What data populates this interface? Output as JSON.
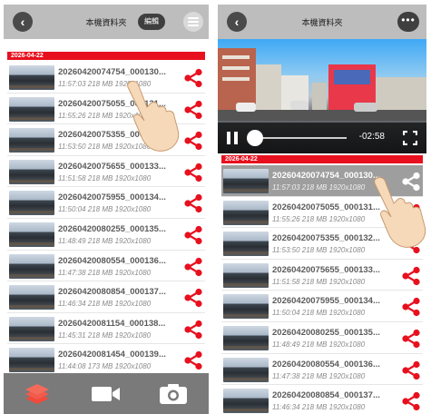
{
  "left": {
    "title": "本機資料夾",
    "edit_label": "編輯",
    "date": "2026-04-22",
    "files": [
      {
        "name": "20260420074754_000130...",
        "meta": "11:57:03 218 MB 1920x1080"
      },
      {
        "name": "20260420075055_000131...",
        "meta": "11:55:26 218 MB 1920x1080"
      },
      {
        "name": "20260420075355_000132...",
        "meta": "11:53:50 218 MB 1920x1080"
      },
      {
        "name": "20260420075655_000133...",
        "meta": "11:51:58 218 MB 1920x1080"
      },
      {
        "name": "20260420075955_000134...",
        "meta": "11:50:04 218 MB 1920x1080"
      },
      {
        "name": "20260420080255_000135...",
        "meta": "11:48:49 218 MB 1920x1080"
      },
      {
        "name": "20260420080554_000136...",
        "meta": "11:47:38 218 MB 1920x1080"
      },
      {
        "name": "20260420080854_000137...",
        "meta": "11:46:34 218 MB 1920x1080"
      },
      {
        "name": "20260420081154_000138...",
        "meta": "11:45:31 218 MB 1920x1080"
      },
      {
        "name": "20260420081454_000139...",
        "meta": "11:44:08 173 MB 1920x1080"
      }
    ],
    "tabs": [
      "layers-icon",
      "video-camera-icon",
      "camera-icon"
    ]
  },
  "right": {
    "title": "本機資料夾",
    "date": "2026-04-22",
    "player": {
      "remaining_time": "-02:58",
      "progress": 0.02
    },
    "files": [
      {
        "name": "20260420074754_000130...",
        "meta": "11:57:03 218 MB 1920x1080",
        "selected": true
      },
      {
        "name": "20260420075055_000131...",
        "meta": "11:55:26 218 MB 1920x1080"
      },
      {
        "name": "20260420075355_000132...",
        "meta": "11:53:50 218 MB 1920x1080"
      },
      {
        "name": "20260420075655_000133...",
        "meta": "11:51:58 218 MB 1920x1080"
      },
      {
        "name": "20260420075955_000134...",
        "meta": "11:50:04 218 MB 1920x1080"
      },
      {
        "name": "20260420080255_000135...",
        "meta": "11:48:49 218 MB 1920x1080"
      },
      {
        "name": "20260420080554_000136...",
        "meta": "11:47:38 218 MB 1920x1080"
      },
      {
        "name": "20260420080854_000137...",
        "meta": "11:46:34 218 MB 1920x1080"
      }
    ]
  },
  "colors": {
    "accent": "#e8101e",
    "share": "#e8101e",
    "topbar": "#bdbdbd",
    "tabbar": "#7a7a7a"
  }
}
